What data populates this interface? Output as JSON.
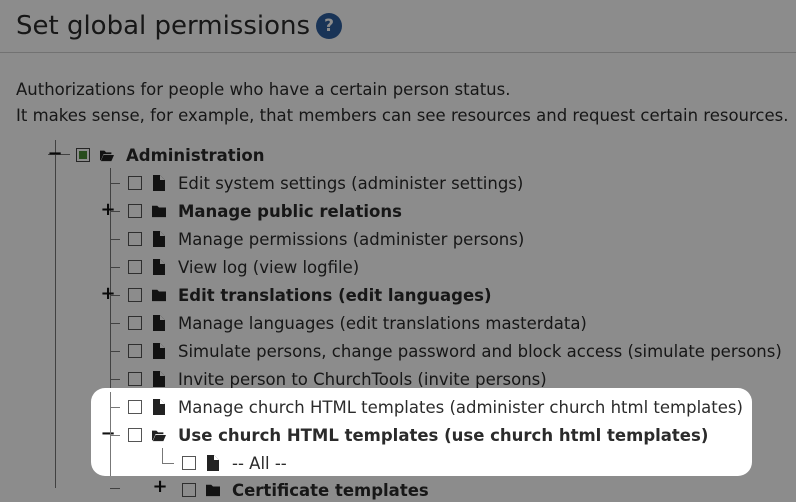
{
  "page": {
    "title": "Set global permissions",
    "help_icon": "?",
    "description_line1": "Authorizations for people who have a certain person status.",
    "description_line2": "It makes sense, for example, that members can see resources and request certain resources."
  },
  "tree": {
    "root": {
      "label": "Administration",
      "state": "partial",
      "icon": "folder-open-icon"
    },
    "items": [
      {
        "label": "Edit system settings (administer settings)",
        "icon": "file-icon",
        "bold": false
      },
      {
        "label": "Manage public relations",
        "icon": "folder-closed-icon",
        "bold": true,
        "expander": "+"
      },
      {
        "label": "Manage permissions (administer persons)",
        "icon": "file-icon",
        "bold": false
      },
      {
        "label": "View log (view logfile)",
        "icon": "file-icon",
        "bold": false
      },
      {
        "label": "Edit translations (edit languages)",
        "icon": "folder-closed-icon",
        "bold": true,
        "expander": "+"
      },
      {
        "label": "Manage languages (edit translations masterdata)",
        "icon": "file-icon",
        "bold": false
      },
      {
        "label": "Simulate persons, change password and block access (simulate persons)",
        "icon": "file-icon",
        "bold": false
      },
      {
        "label": "Invite person to ChurchTools (invite persons)",
        "icon": "file-icon",
        "bold": false
      },
      {
        "label": "Manage church HTML templates (administer church html templates)",
        "icon": "file-icon",
        "bold": false
      },
      {
        "label": "Use church HTML templates (use church html templates)",
        "icon": "folder-open-icon",
        "bold": true,
        "expander": "−"
      }
    ],
    "sub_item": {
      "label": "-- All --",
      "icon": "file-icon"
    },
    "cut_off_item": {
      "label": "Certificate templates",
      "icon": "folder-closed-icon",
      "expander": "+"
    }
  },
  "colors": {
    "help_bg": "#2f5f9e",
    "partial_check": "#4a8a35",
    "dim_overlay": "rgba(0,0,0,0.45)"
  }
}
